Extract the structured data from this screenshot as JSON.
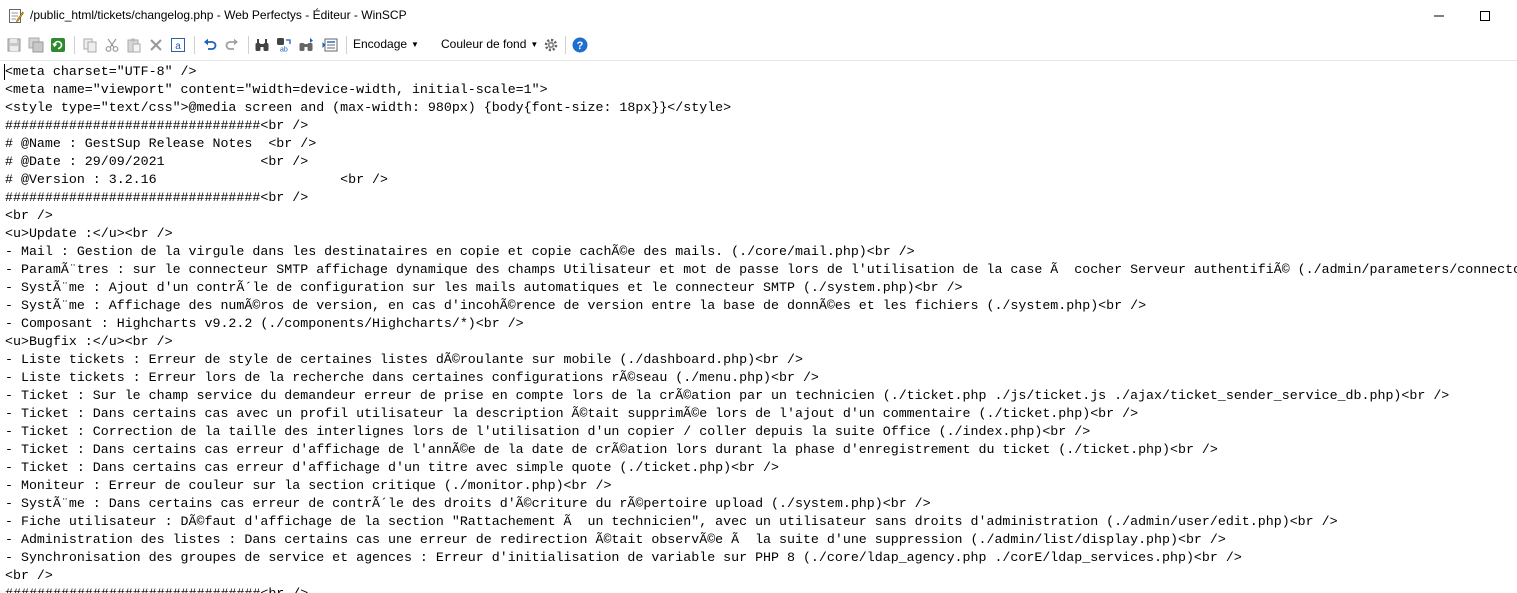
{
  "window": {
    "title": "/public_html/tickets/changelog.php - Web Perfectys - Éditeur - WinSCP",
    "minimize_glyph": "—",
    "maximize_glyph": "☐"
  },
  "toolbar": {
    "encoding_label": "Encodage",
    "background_color_label": "Couleur de fond",
    "icons": [
      "save-icon",
      "save-all-icon",
      "reload-icon",
      "copy-icon",
      "cut-icon",
      "paste-icon",
      "delete-icon",
      "select-all-icon",
      "undo-icon",
      "redo-icon",
      "find-icon",
      "replace-icon",
      "find-next-icon",
      "goto-line-icon",
      "settings-icon",
      "help-icon"
    ]
  },
  "editor": {
    "lines": [
      "<meta charset=\"UTF-8\" />",
      "<meta name=\"viewport\" content=\"width=device-width, initial-scale=1\">",
      "<style type=\"text/css\">@media screen and (max-width: 980px) {body{font-size: 18px}}</style>",
      "################################<br />",
      "# @Name : GestSup Release Notes  <br />",
      "# @Date : 29/09/2021            <br />",
      "# @Version : 3.2.16                       <br />",
      "################################<br />",
      "<br />",
      "<u>Update :</u><br />",
      "- Mail : Gestion de la virgule dans les destinataires en copie et copie cachÃ©e des mails. (./core/mail.php)<br />",
      "- ParamÃ¨tres : sur le connecteur SMTP affichage dynamique des champs Utilisateur et mot de passe lors de l'utilisation de la case Ã  cocher Serveur authentifiÃ© (./admin/parameters/connector.php)<br />",
      "- SystÃ¨me : Ajout d'un contrÃ´le de configuration sur les mails automatiques et le connecteur SMTP (./system.php)<br />",
      "- SystÃ¨me : Affichage des numÃ©ros de version, en cas d'incohÃ©rence de version entre la base de donnÃ©es et les fichiers (./system.php)<br />",
      "- Composant : Highcharts v9.2.2 (./components/Highcharts/*)<br />",
      "<u>Bugfix :</u><br />",
      "- Liste tickets : Erreur de style de certaines listes dÃ©roulante sur mobile (./dashboard.php)<br />",
      "- Liste tickets : Erreur lors de la recherche dans certaines configurations rÃ©seau (./menu.php)<br />",
      "- Ticket : Sur le champ service du demandeur erreur de prise en compte lors de la crÃ©ation par un technicien (./ticket.php ./js/ticket.js ./ajax/ticket_sender_service_db.php)<br />",
      "- Ticket : Dans certains cas avec un profil utilisateur la description Ã©tait supprimÃ©e lors de l'ajout d'un commentaire (./ticket.php)<br />",
      "- Ticket : Correction de la taille des interlignes lors de l'utilisation d'un copier / coller depuis la suite Office (./index.php)<br />",
      "- Ticket : Dans certains cas erreur d'affichage de l'annÃ©e de la date de crÃ©ation lors durant la phase d'enregistrement du ticket (./ticket.php)<br />",
      "- Ticket : Dans certains cas erreur d'affichage d'un titre avec simple quote (./ticket.php)<br />",
      "- Moniteur : Erreur de couleur sur la section critique (./monitor.php)<br />",
      "- SystÃ¨me : Dans certains cas erreur de contrÃ´le des droits d'Ã©criture du rÃ©pertoire upload (./system.php)<br />",
      "- Fiche utilisateur : DÃ©faut d'affichage de la section \"Rattachement Ã  un technicien\", avec un utilisateur sans droits d'administration (./admin/user/edit.php)<br />",
      "- Administration des listes : Dans certains cas une erreur de redirection Ã©tait observÃ©e Ã  la suite d'une suppression (./admin/list/display.php)<br />",
      "- Synchronisation des groupes de service et agences : Erreur d'initialisation de variable sur PHP 8 (./core/ldap_agency.php ./corE/ldap_services.php)<br />",
      "<br />",
      "################################<br />"
    ]
  }
}
